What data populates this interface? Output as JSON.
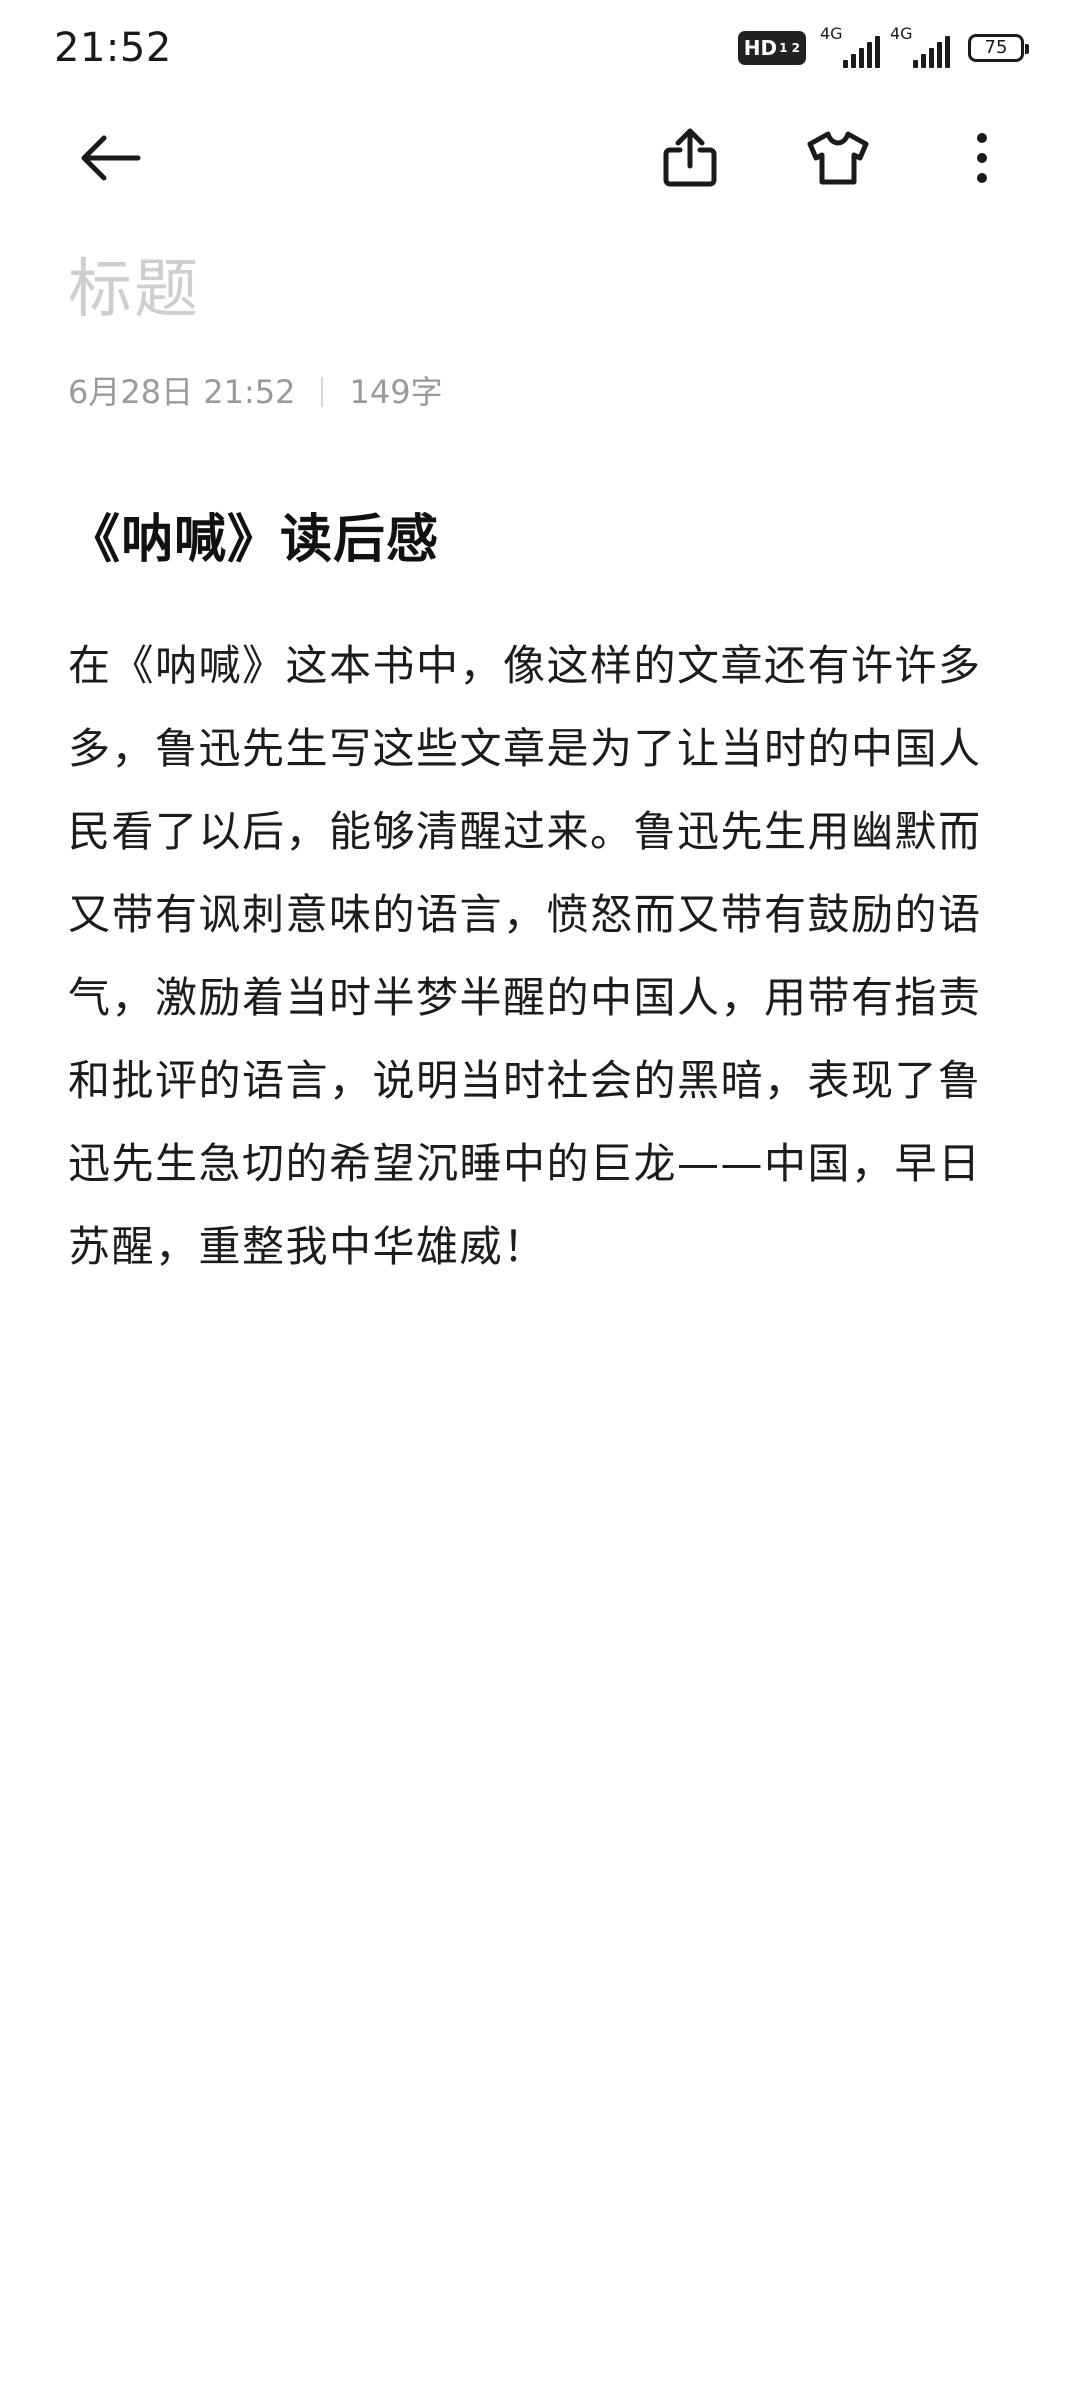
{
  "status_bar": {
    "time": "21:52",
    "hd_label": "HD",
    "hd_sub": "1 2",
    "network_1": "4G",
    "network_2": "4G",
    "battery": "75"
  },
  "toolbar": {
    "back_icon": "arrow-left-icon",
    "share_icon": "share-icon",
    "theme_icon": "tshirt-icon",
    "more_icon": "more-vertical-icon"
  },
  "note": {
    "title_placeholder": "标题",
    "date": "6月28日 21:52",
    "word_count": "149字",
    "heading": "《呐喊》读后感",
    "body": "在《呐喊》这本书中，像这样的文章还有许许多多，鲁迅先生写这些文章是为了让当时的中国人民看了以后，能够清醒过来。鲁迅先生用幽默而又带有讽刺意味的语言，愤怒而又带有鼓励的语气，激励着当时半梦半醒的中国人，用带有指责和批评的语言，说明当时社会的黑暗，表现了鲁迅先生急切的希望沉睡中的巨龙——中国，早日苏醒，重整我中华雄威！"
  }
}
